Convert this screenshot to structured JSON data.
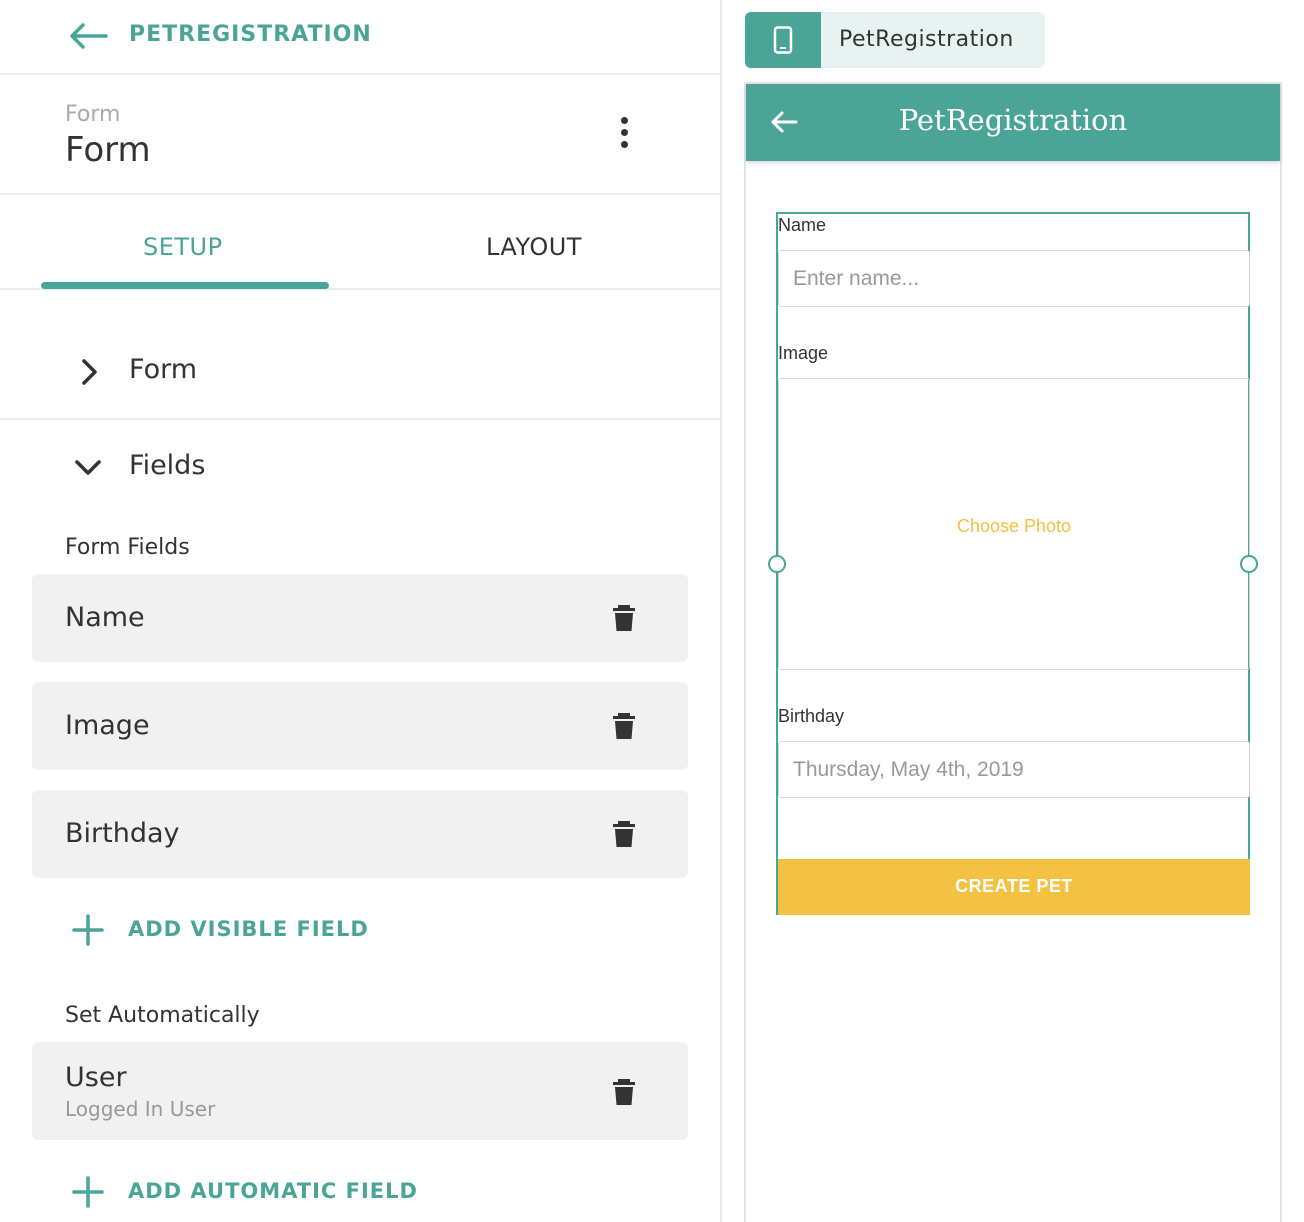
{
  "colors": {
    "accent": "#4aa596",
    "button": "#f4c242",
    "choose_photo": "#f1c03f"
  },
  "nav": {
    "back_icon": "arrow-left-icon",
    "app_name": "PETREGISTRATION"
  },
  "screen": {
    "subtitle": "Form",
    "title": "Form",
    "more_icon": "more-vertical-icon"
  },
  "tabs": [
    {
      "label": "SETUP",
      "active": true
    },
    {
      "label": "LAYOUT",
      "active": false
    }
  ],
  "sections": {
    "form": {
      "label": "Form",
      "expanded": false
    },
    "fields": {
      "label": "Fields",
      "expanded": true
    }
  },
  "form_fields": {
    "heading": "Form Fields",
    "items": [
      {
        "label": "Name"
      },
      {
        "label": "Image"
      },
      {
        "label": "Birthday"
      }
    ],
    "add_label": "ADD VISIBLE FIELD"
  },
  "auto_fields": {
    "heading": "Set Automatically",
    "items": [
      {
        "label": "User",
        "sublabel": "Logged In User"
      }
    ],
    "add_label": "ADD AUTOMATIC FIELD"
  },
  "preview": {
    "device_icon": "smartphone-icon",
    "app_name": "PetRegistration",
    "screen_title": "PetRegistration",
    "fields": {
      "name": {
        "label": "Name",
        "placeholder": "Enter name..."
      },
      "image": {
        "label": "Image",
        "action": "Choose Photo"
      },
      "birthday": {
        "label": "Birthday",
        "placeholder": "Thursday, May 4th, 2019"
      }
    },
    "submit": "CREATE PET"
  }
}
